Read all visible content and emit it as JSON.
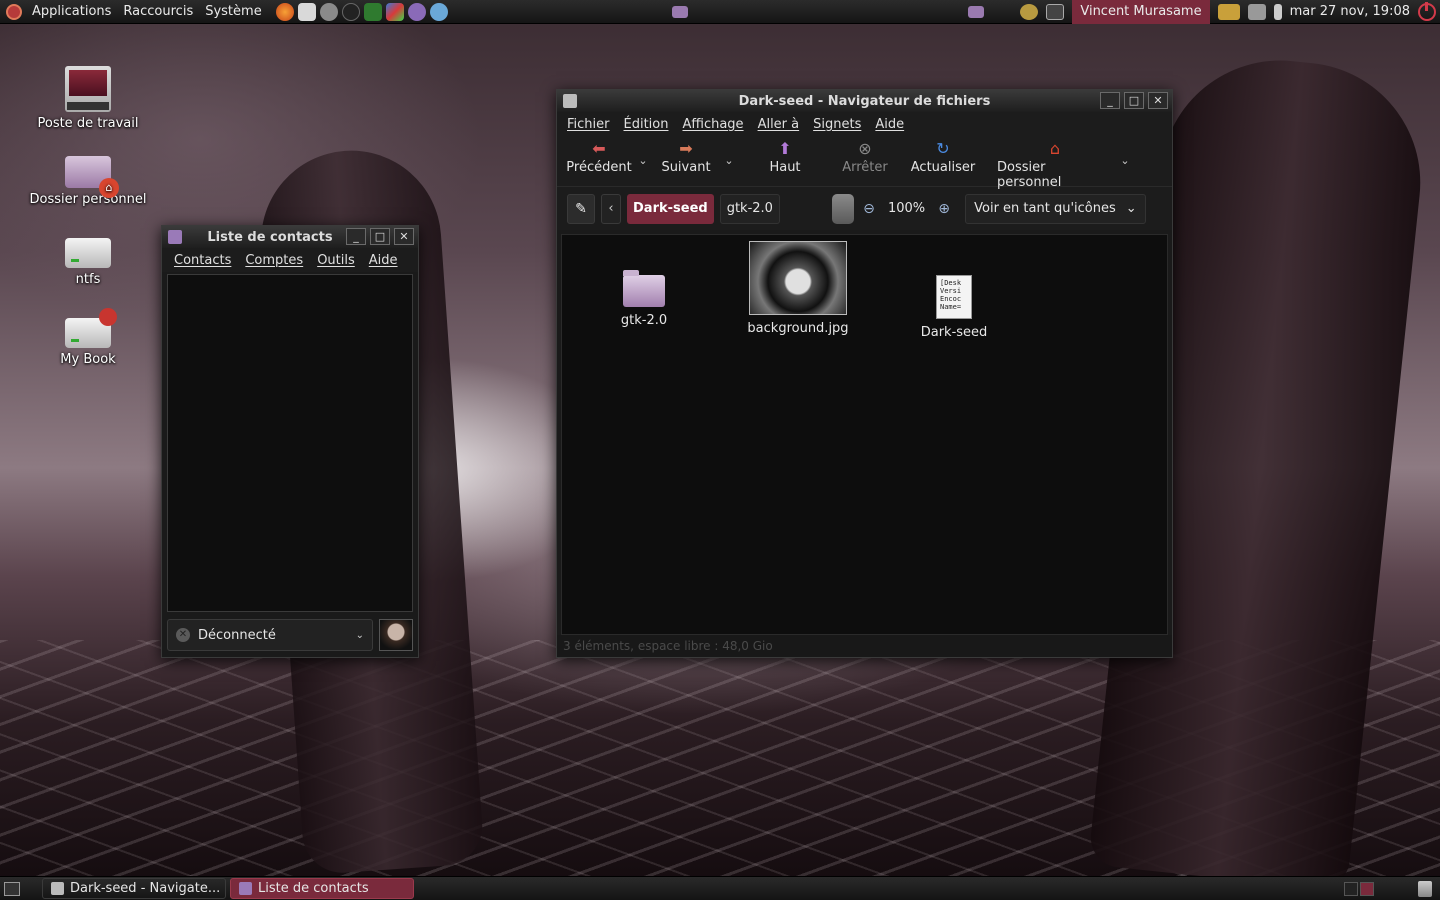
{
  "top_panel": {
    "menus": [
      "Applications",
      "Raccourcis",
      "Système"
    ],
    "user": "Vincent Murasame",
    "clock": "mar 27 nov, 19:08"
  },
  "desktop_icons": [
    {
      "label": "Poste de travail",
      "icon": "computer-icon"
    },
    {
      "label": "Dossier personnel",
      "icon": "home-folder-icon"
    },
    {
      "label": "ntfs",
      "icon": "drive-icon"
    },
    {
      "label": "My Book",
      "icon": "usb-drive-icon"
    }
  ],
  "nautilus": {
    "title": "Dark-seed - Navigateur de fichiers",
    "menus": [
      "Fichier",
      "Édition",
      "Affichage",
      "Aller à",
      "Signets",
      "Aide"
    ],
    "toolbar": {
      "back": "Précédent",
      "forward": "Suivant",
      "up": "Haut",
      "stop": "Arrêter",
      "reload": "Actualiser",
      "home": "Dossier personnel"
    },
    "path": {
      "current": "Dark-seed",
      "next": "gtk-2.0"
    },
    "zoom": "100%",
    "view_mode": "Voir en tant qu'icônes",
    "files": [
      {
        "name": "gtk-2.0",
        "type": "folder"
      },
      {
        "name": "background.jpg",
        "type": "image"
      },
      {
        "name": "Dark-seed",
        "type": "desktop-file",
        "preview": "[Desk\nVersi\nEncoc\nName="
      }
    ],
    "status": "3 éléments, espace libre : 48,0 Gio"
  },
  "pidgin": {
    "title": "Liste de contacts",
    "menus": [
      "Contacts",
      "Comptes",
      "Outils",
      "Aide"
    ],
    "status": "Déconnecté"
  },
  "taskbar": {
    "tasks": [
      "Dark-seed - Navigate...",
      "Liste de contacts"
    ]
  },
  "colors": {
    "accent": "#7a2a3c",
    "panel": "#1b1b1b",
    "window_bg": "#1a1a1a"
  }
}
